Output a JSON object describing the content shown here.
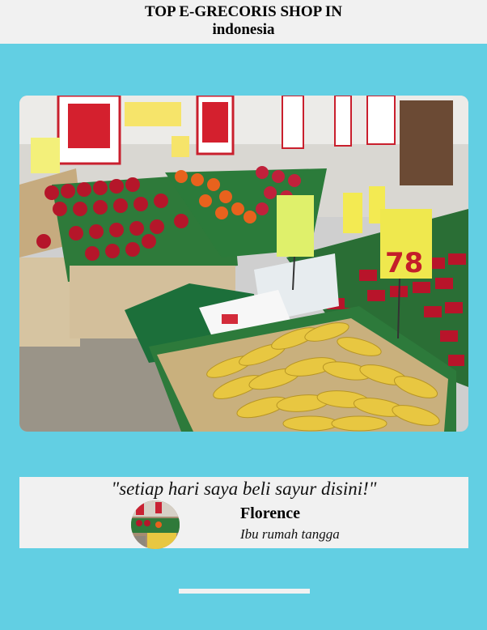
{
  "header": {
    "title_line1": "TOP E-GRECORIS SHOP IN",
    "title_line2": "indonesia"
  },
  "hero_image": {
    "description_icon": "supermarket-produce-photo"
  },
  "testimonial": {
    "quote": "\"setiap hari saya beli sayur disini!\"",
    "name": "Florence",
    "role": "Ibu rumah tangga"
  },
  "colors": {
    "background": "#62cfe3",
    "panel": "#f1f1f1"
  }
}
